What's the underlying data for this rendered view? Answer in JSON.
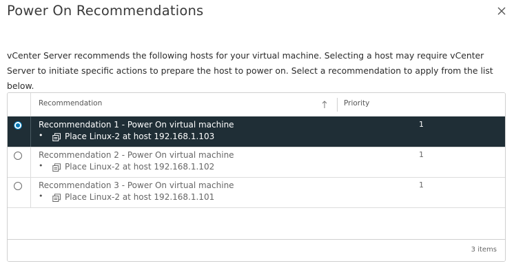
{
  "dialog": {
    "title": "Power On Recommendations",
    "description": "vCenter Server recommends the following hosts for your virtual machine. Selecting a host may require vCenter Server to initiate specific actions to prepare the host to power on. Select a recommendation to apply from the list below."
  },
  "grid": {
    "columns": {
      "recommendation": "Recommendation",
      "priority": "Priority"
    },
    "sort_icon": "arrow-up-icon",
    "selected_row": 0,
    "rows": [
      {
        "title": "Recommendation 1 - Power On virtual machine",
        "action": "Place Linux-2 at host 192.168.1.103",
        "priority": "1",
        "bullet": "•"
      },
      {
        "title": "Recommendation 2 - Power On virtual machine",
        "action": "Place Linux-2 at host 192.168.1.102",
        "priority": "1",
        "bullet": "•"
      },
      {
        "title": "Recommendation 3 - Power On virtual machine",
        "action": "Place Linux-2 at host 192.168.1.101",
        "priority": "1",
        "bullet": "•"
      }
    ],
    "footer": {
      "count": "3 items"
    }
  },
  "colors": {
    "selected_row_bg": "#1f2e36",
    "radio_accent": "#0079b8"
  }
}
